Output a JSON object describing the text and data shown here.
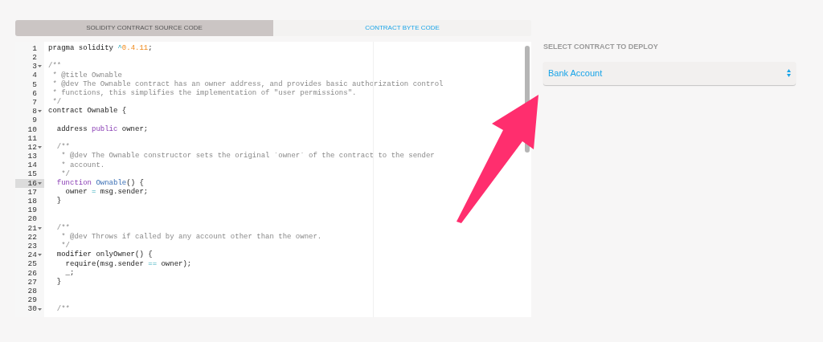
{
  "tabs": [
    {
      "label": "SOLIDITY CONTRACT SOURCE CODE",
      "selected": true
    },
    {
      "label": "CONTRACT BYTE CODE",
      "selected": false
    }
  ],
  "editor": {
    "lines": [
      {
        "number": "1",
        "fold": false,
        "active": false,
        "tokens": [
          {
            "kind": "plain",
            "text": "pragma solidity "
          },
          {
            "kind": "operator",
            "text": "^"
          },
          {
            "kind": "number",
            "text": "0.4.11"
          },
          {
            "kind": "plain",
            "text": ";"
          }
        ]
      },
      {
        "number": "2",
        "fold": false,
        "active": false
      },
      {
        "number": "3",
        "fold": true,
        "active": false,
        "tokens": [
          {
            "kind": "comment",
            "text": "/**"
          }
        ]
      },
      {
        "number": "4",
        "fold": false,
        "active": false,
        "tokens": [
          {
            "kind": "comment",
            "text": " * @title Ownable"
          }
        ]
      },
      {
        "number": "5",
        "fold": false,
        "active": false,
        "tokens": [
          {
            "kind": "comment",
            "text": " * @dev The Ownable contract has an owner address, and provides basic authorization control"
          }
        ]
      },
      {
        "number": "6",
        "fold": false,
        "active": false,
        "tokens": [
          {
            "kind": "comment",
            "text": " * functions, this simplifies the implementation of \"user permissions\"."
          }
        ]
      },
      {
        "number": "7",
        "fold": false,
        "active": false,
        "tokens": [
          {
            "kind": "comment",
            "text": " */"
          }
        ]
      },
      {
        "number": "8",
        "fold": true,
        "active": false,
        "tokens": [
          {
            "kind": "plain",
            "text": "contract Ownable {"
          }
        ]
      },
      {
        "number": "9",
        "fold": false,
        "active": false
      },
      {
        "number": "10",
        "fold": false,
        "active": false,
        "tokens": [
          {
            "kind": "plain",
            "text": "  address "
          },
          {
            "kind": "keyword",
            "text": "public"
          },
          {
            "kind": "plain",
            "text": " owner;"
          }
        ]
      },
      {
        "number": "11",
        "fold": false,
        "active": false
      },
      {
        "number": "12",
        "fold": true,
        "active": false,
        "tokens": [
          {
            "kind": "comment",
            "text": "  /**"
          }
        ]
      },
      {
        "number": "13",
        "fold": false,
        "active": false,
        "tokens": [
          {
            "kind": "comment",
            "text": "   * @dev The Ownable constructor sets the original `owner` of the contract to the sender"
          }
        ]
      },
      {
        "number": "14",
        "fold": false,
        "active": false,
        "tokens": [
          {
            "kind": "comment",
            "text": "   * account."
          }
        ]
      },
      {
        "number": "15",
        "fold": false,
        "active": false,
        "tokens": [
          {
            "kind": "comment",
            "text": "   */"
          }
        ]
      },
      {
        "number": "16",
        "fold": true,
        "active": true,
        "tokens": [
          {
            "kind": "keyword",
            "text": "  function"
          },
          {
            "kind": "def",
            "text": " Ownable"
          },
          {
            "kind": "plain",
            "text": "() {"
          }
        ]
      },
      {
        "number": "17",
        "fold": false,
        "active": false,
        "tokens": [
          {
            "kind": "plain",
            "text": "    owner "
          },
          {
            "kind": "operator",
            "text": "="
          },
          {
            "kind": "plain",
            "text": " msg.sender;"
          }
        ]
      },
      {
        "number": "18",
        "fold": false,
        "active": false,
        "tokens": [
          {
            "kind": "plain",
            "text": "  }"
          }
        ]
      },
      {
        "number": "19",
        "fold": false,
        "active": false
      },
      {
        "number": "20",
        "fold": false,
        "active": false
      },
      {
        "number": "21",
        "fold": true,
        "active": false,
        "tokens": [
          {
            "kind": "comment",
            "text": "  /**"
          }
        ]
      },
      {
        "number": "22",
        "fold": false,
        "active": false,
        "tokens": [
          {
            "kind": "comment",
            "text": "   * @dev Throws if called by any account other than the owner."
          }
        ]
      },
      {
        "number": "23",
        "fold": false,
        "active": false,
        "tokens": [
          {
            "kind": "comment",
            "text": "   */"
          }
        ]
      },
      {
        "number": "24",
        "fold": true,
        "active": false,
        "tokens": [
          {
            "kind": "plain",
            "text": "  modifier onlyOwner() {"
          }
        ]
      },
      {
        "number": "25",
        "fold": false,
        "active": false,
        "tokens": [
          {
            "kind": "plain",
            "text": "    require(msg.sender "
          },
          {
            "kind": "operator",
            "text": "=="
          },
          {
            "kind": "plain",
            "text": " owner);"
          }
        ]
      },
      {
        "number": "26",
        "fold": false,
        "active": false,
        "tokens": [
          {
            "kind": "plain",
            "text": "    _;"
          }
        ]
      },
      {
        "number": "27",
        "fold": false,
        "active": false,
        "tokens": [
          {
            "kind": "plain",
            "text": "  }"
          }
        ]
      },
      {
        "number": "28",
        "fold": false,
        "active": false
      },
      {
        "number": "29",
        "fold": false,
        "active": false
      },
      {
        "number": "30",
        "fold": true,
        "active": false,
        "tokens": [
          {
            "kind": "comment",
            "text": "  /**"
          }
        ]
      }
    ]
  },
  "deploy": {
    "label": "SELECT CONTRACT TO DEPLOY",
    "value": "Bank Account"
  }
}
